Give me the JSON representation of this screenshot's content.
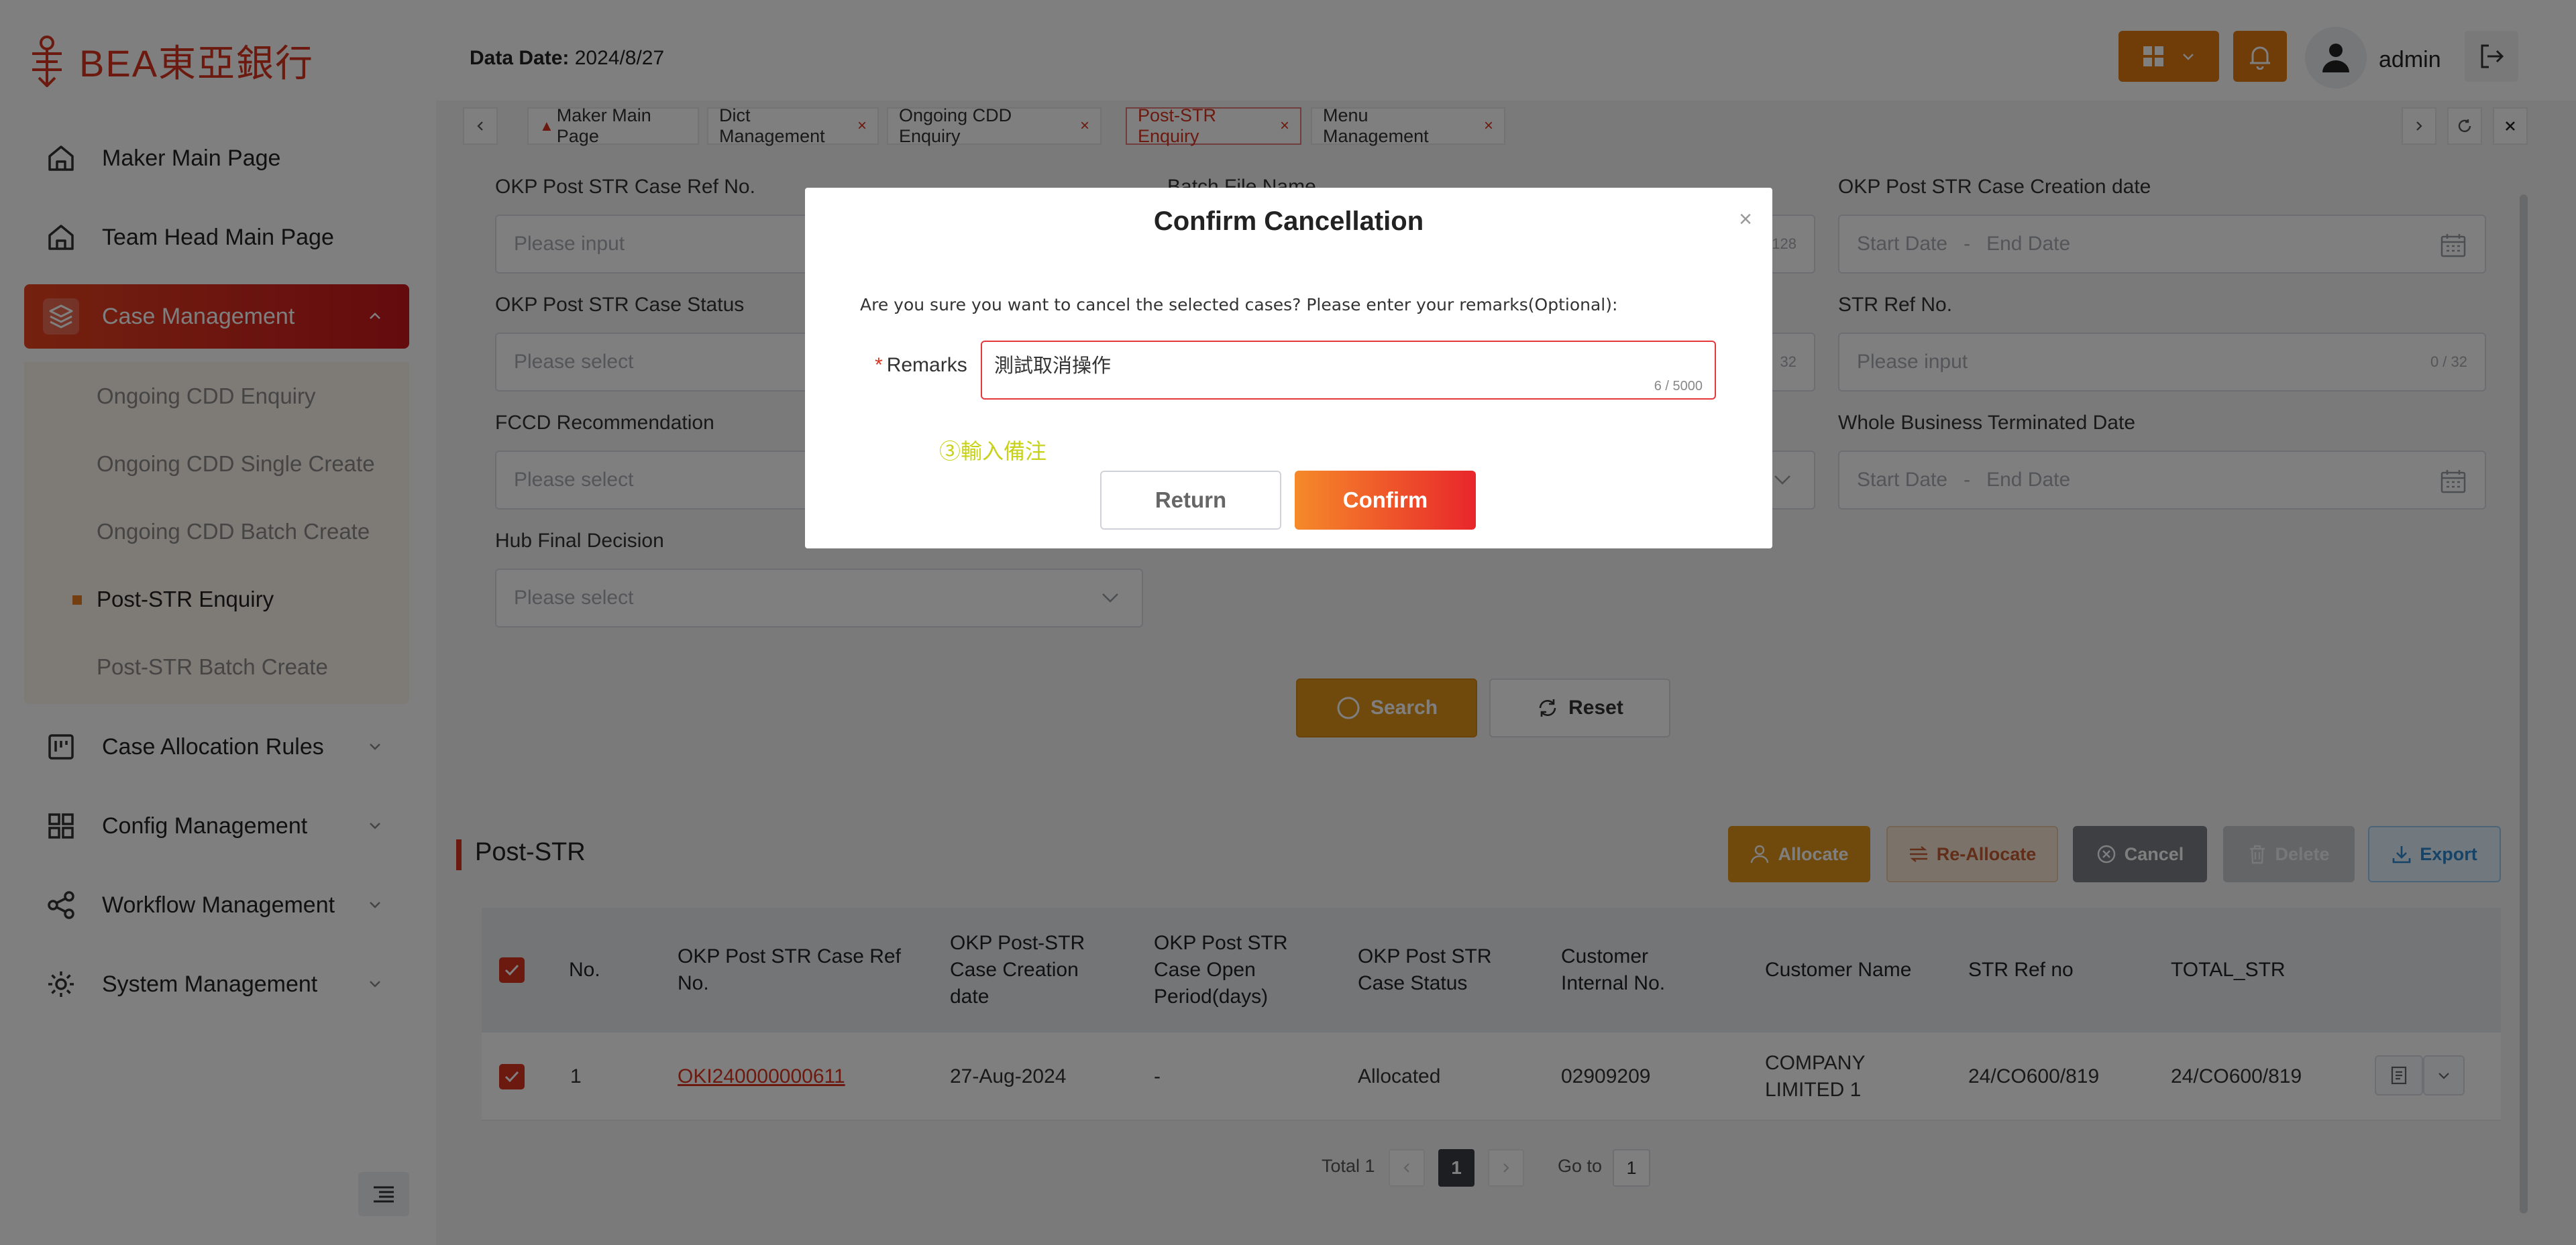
{
  "brand": {
    "logo_text": "BEA東亞銀行",
    "color": "#d9341f"
  },
  "sidebar": {
    "items": [
      {
        "label": "Maker Main Page",
        "icon": "home-icon"
      },
      {
        "label": "Team Head Main Page",
        "icon": "home-icon"
      },
      {
        "label": "Case Management",
        "icon": "layers-icon",
        "expanded": true,
        "active": true
      },
      {
        "label": "Case Allocation Rules",
        "icon": "board-icon"
      },
      {
        "label": "Config Management",
        "icon": "grid-icon"
      },
      {
        "label": "Workflow Management",
        "icon": "share-icon"
      },
      {
        "label": "System Management",
        "icon": "gear-icon"
      }
    ],
    "submenu": [
      {
        "label": "Ongoing CDD Enquiry"
      },
      {
        "label": "Ongoing CDD Single Create"
      },
      {
        "label": "Ongoing CDD Batch Create"
      },
      {
        "label": "Post-STR Enquiry",
        "active": true
      },
      {
        "label": "Post-STR Batch Create"
      }
    ]
  },
  "header": {
    "data_date_label": "Data Date:",
    "data_date_value": "2024/8/27",
    "user": "admin"
  },
  "tabs": [
    {
      "label": "Maker Main Page",
      "closable": false
    },
    {
      "label": "Dict Management",
      "closable": true
    },
    {
      "label": "Ongoing CDD Enquiry",
      "closable": true
    },
    {
      "label": "Post-STR Enquiry",
      "closable": true,
      "active": true
    },
    {
      "label": "Menu Management",
      "closable": true
    }
  ],
  "tab_close_glyph": "×",
  "filters": {
    "case_ref_label": "OKP Post STR Case Ref No.",
    "case_ref_placeholder": "Please input",
    "batch_file_label": "Batch File Name",
    "batch_file_counter": "128",
    "creation_date_label": "OKP Post STR Case Creation date",
    "start_date": "Start Date",
    "end_date": "End Date",
    "range_sep": "-",
    "case_status_label": "OKP Post STR Case Status",
    "select_placeholder": "Please select",
    "middle_counter": "32",
    "str_ref_label": "STR Ref No.",
    "str_ref_placeholder": "Please input",
    "str_ref_counter": "0 / 32",
    "fccd_label": "FCCD Recommendation",
    "whole_business_label": "Whole Business Terminated Date",
    "hub_label": "Hub Final Decision"
  },
  "buttons": {
    "search": "Search",
    "reset": "Reset",
    "allocate": "Allocate",
    "reallocate": "Re-Allocate",
    "cancel": "Cancel",
    "delete": "Delete",
    "export": "Export"
  },
  "section_title": "Post-STR",
  "table": {
    "headers": [
      "No.",
      "OKP Post STR Case Ref No.",
      "OKP Post-STR Case Creation date",
      "OKP Post STR Case Open Period(days)",
      "OKP Post STR Case Status",
      "Customer Internal No.",
      "Customer Name",
      "STR Ref no",
      "TOTAL_STR"
    ],
    "rows": [
      {
        "no": "1",
        "case_ref": "OKI240000000611",
        "creation_date": "27-Aug-2024",
        "open_period": "-",
        "status": "Allocated",
        "customer_internal_no": "02909209",
        "customer_name": "COMPANY LIMITED 1",
        "str_ref": "24/CO600/819",
        "total_str": "24/CO600/819"
      }
    ]
  },
  "pagination": {
    "total": "Total 1",
    "current": "1",
    "goto_label": "Go to",
    "goto_value": "1"
  },
  "modal": {
    "title": "Confirm Cancellation",
    "close_glyph": "×",
    "description": "Are you sure you want to cancel the selected cases? Please enter your remarks(Optional):",
    "remarks_label": "Remarks",
    "required_mark": "*",
    "remarks_value": "測試取消操作",
    "remarks_counter": "6 / 5000",
    "hint": "③輸入備注",
    "return_label": "Return",
    "confirm_label": "Confirm"
  },
  "colors": {
    "brand_red": "#d9341f",
    "accent_orange": "#e0921a",
    "submenu_bg": "#fdf5ea",
    "hint_color": "#c8d21a"
  }
}
